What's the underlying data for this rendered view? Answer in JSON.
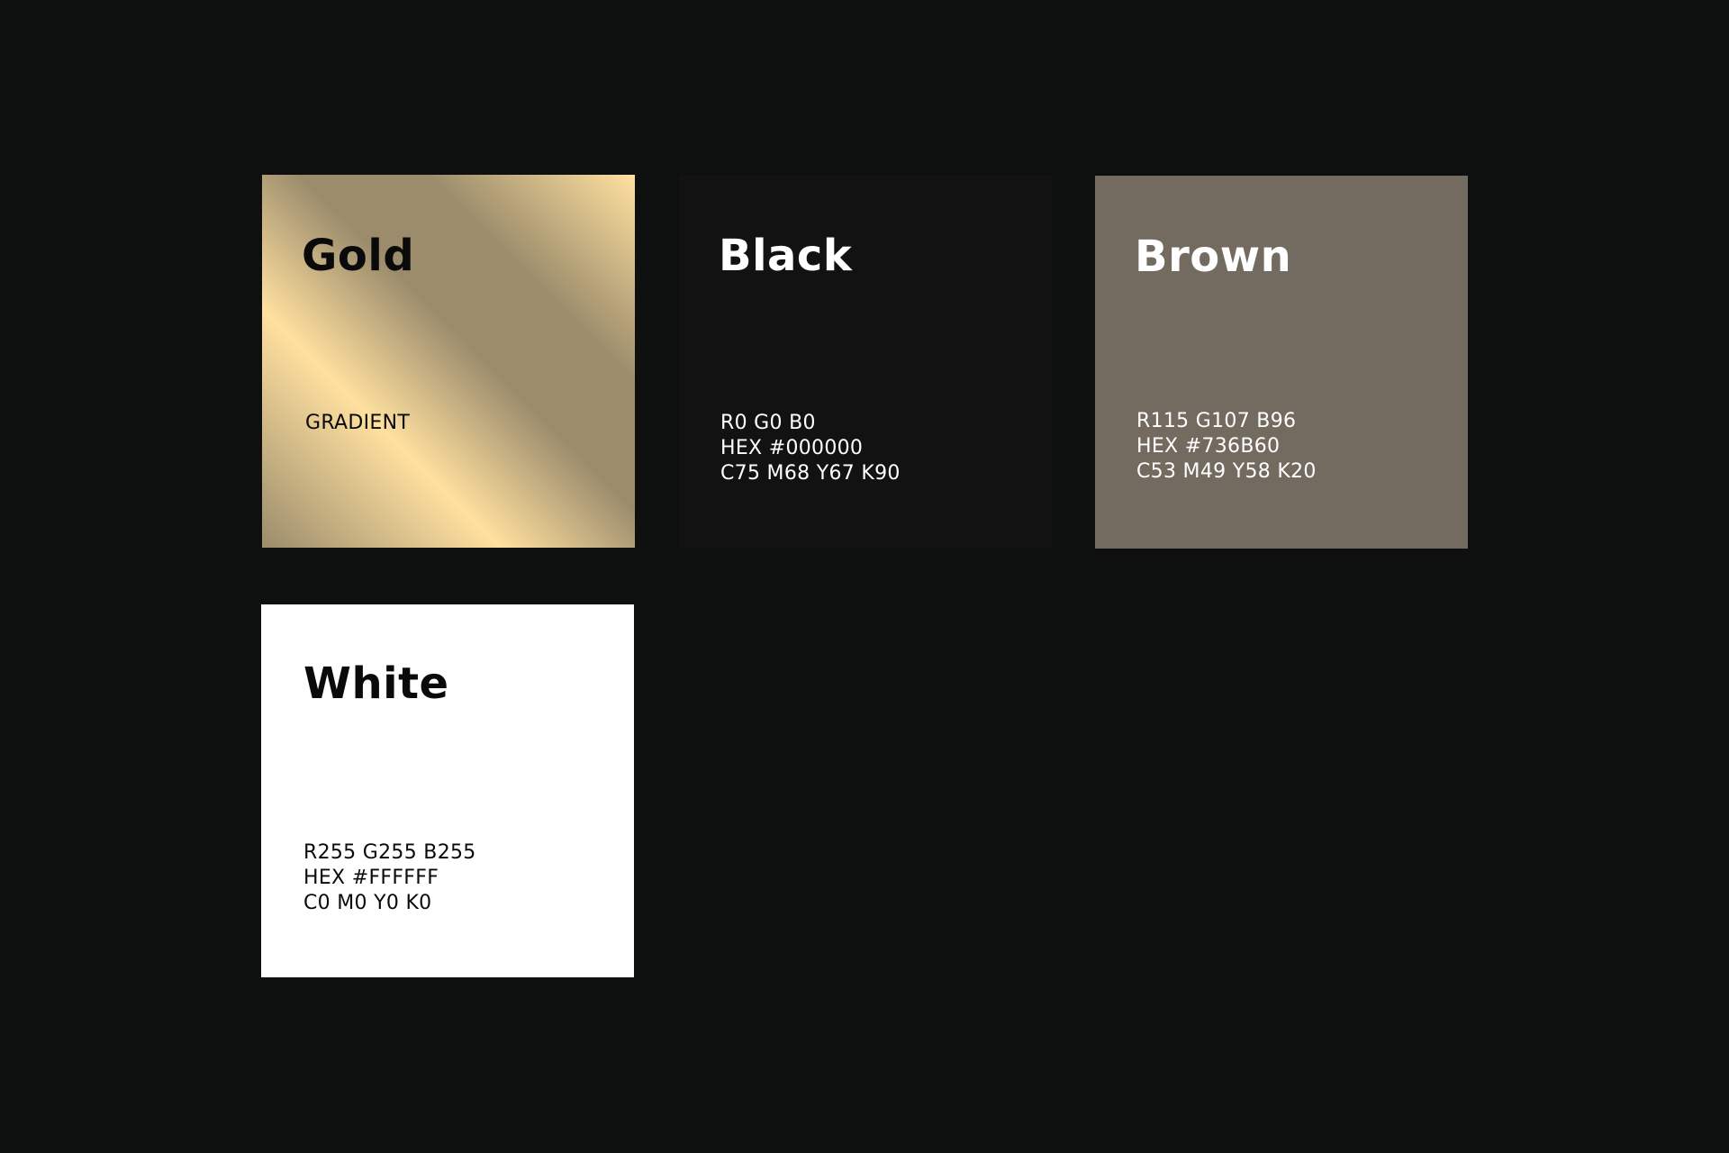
{
  "swatches": [
    {
      "id": "gold",
      "name": "Gold",
      "specs": [
        "GRADIENT"
      ],
      "background": "linear-gradient",
      "gradient_colors": [
        "#9b8c6c",
        "#ffe09f",
        "#9b8c6c",
        "#9b8c6c",
        "#ffe09f"
      ],
      "text_color": "#0a0a0a"
    },
    {
      "id": "black",
      "name": "Black",
      "specs": [
        "R0 G0 B0",
        "HEX #000000",
        "C75 M68 Y67 K90"
      ],
      "background": "#121212",
      "text_color": "#ffffff"
    },
    {
      "id": "brown",
      "name": "Brown",
      "specs": [
        "R115 G107 B96",
        "HEX #736B60",
        "C53 M49 Y58 K20"
      ],
      "background": "#736b60",
      "text_color": "#ffffff"
    },
    {
      "id": "white",
      "name": "White",
      "specs": [
        "R255 G255 B255",
        "HEX #FFFFFF",
        "C0 M0 Y0 K0"
      ],
      "background": "#ffffff",
      "text_color": "#0a0a0a"
    }
  ],
  "page_background": "#0e0f0f"
}
